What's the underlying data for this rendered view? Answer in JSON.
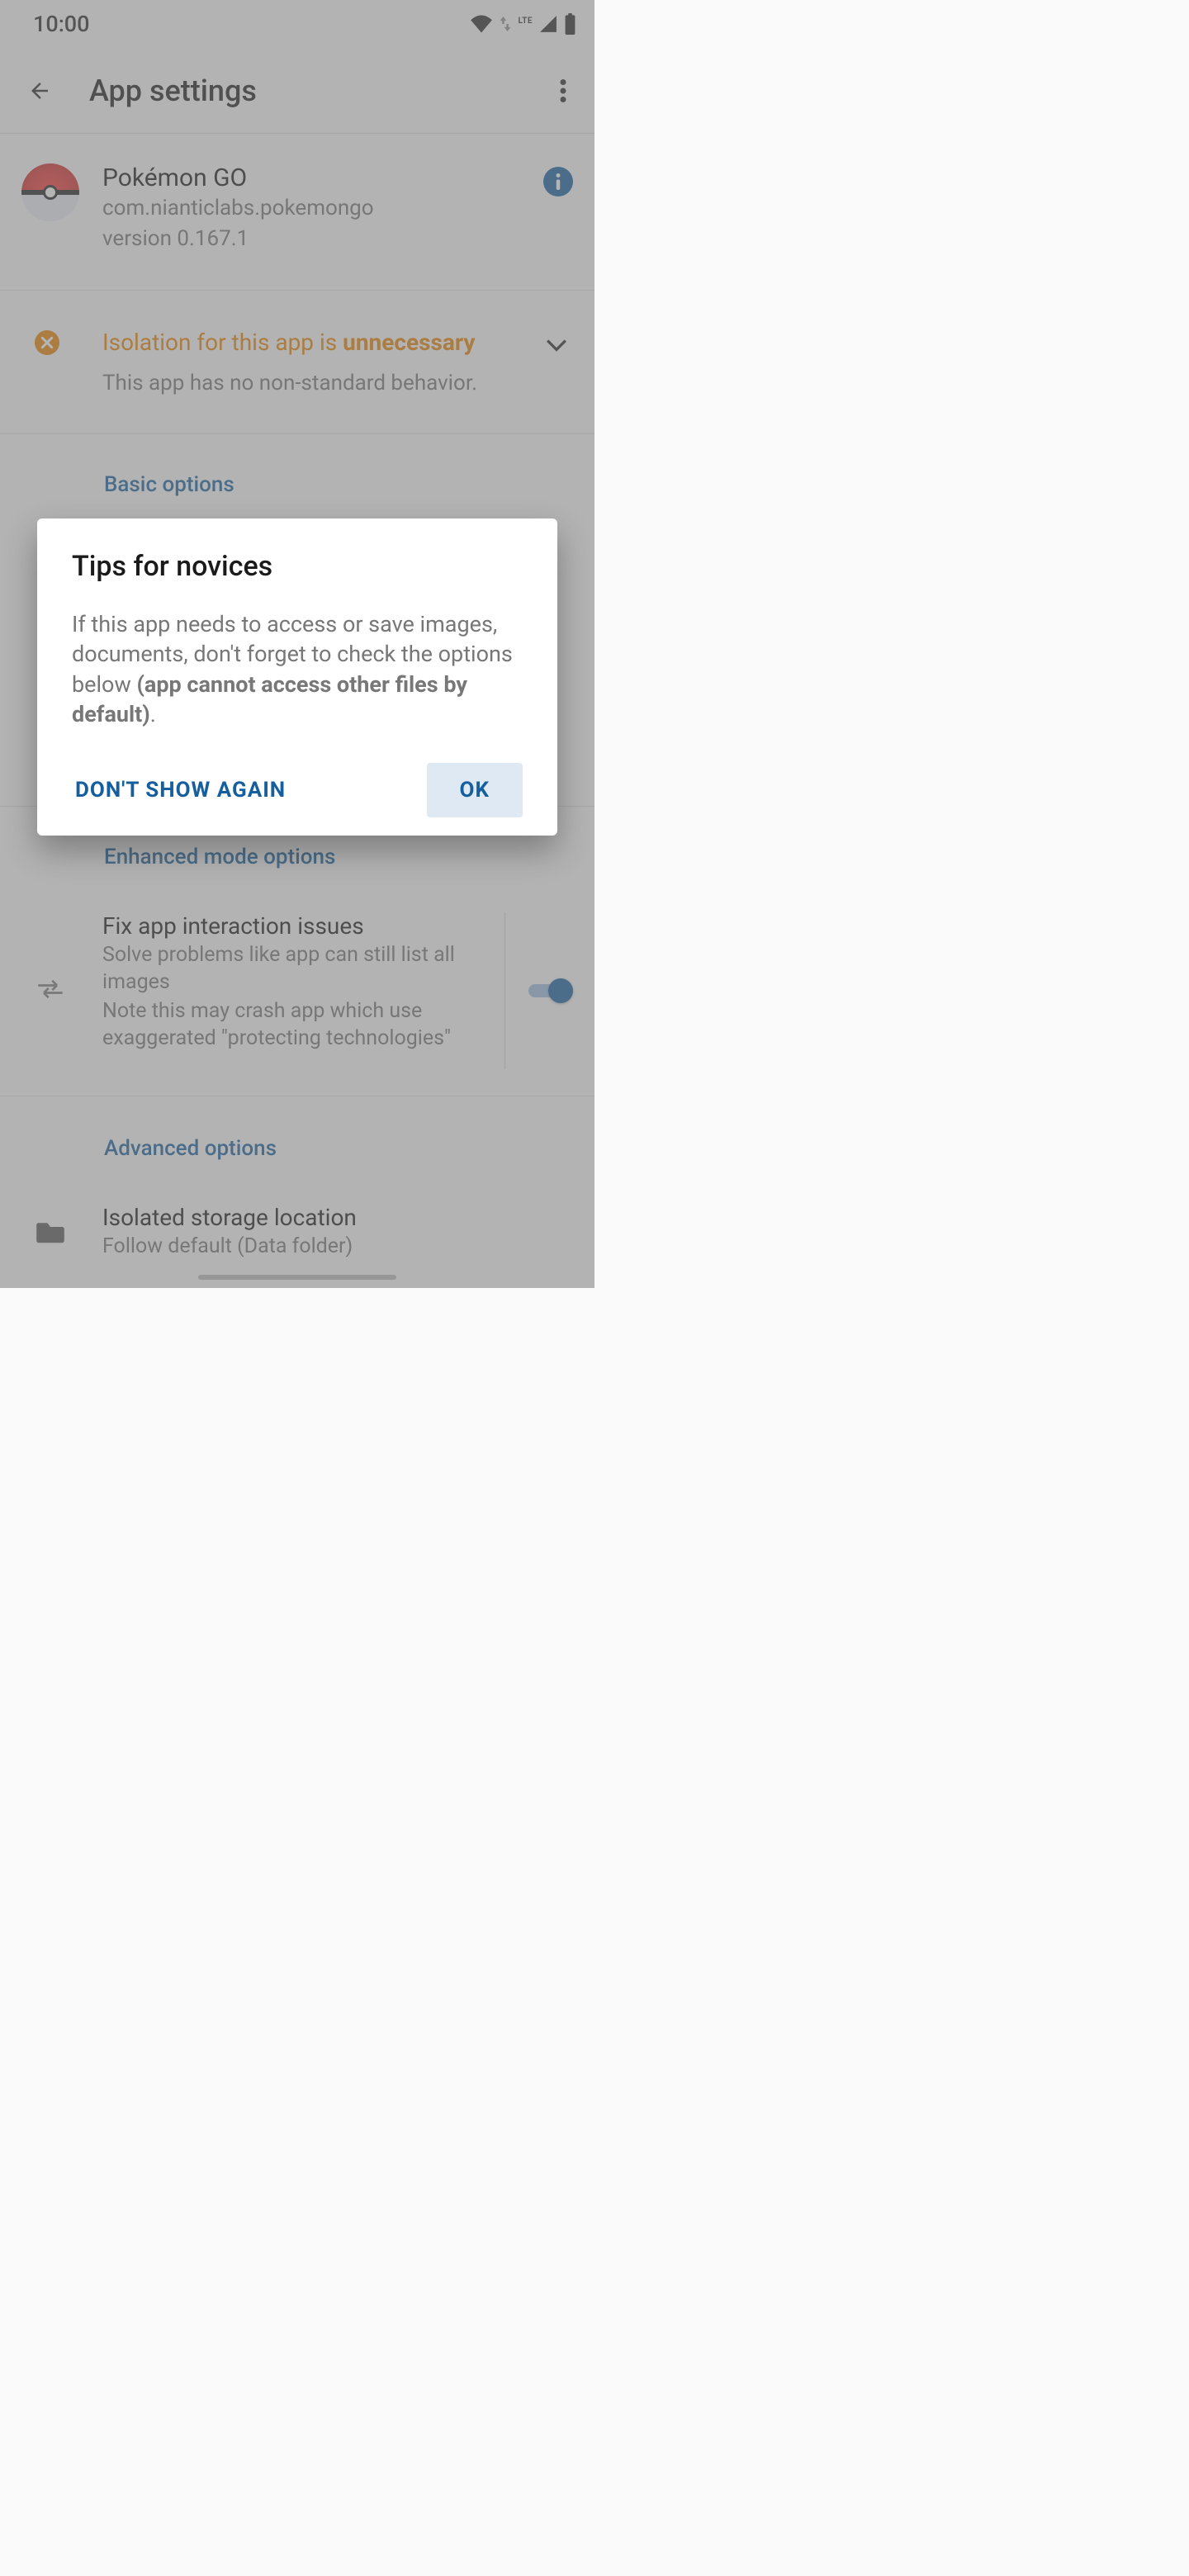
{
  "status": {
    "time": "10:00",
    "lte": "LTE"
  },
  "appbar": {
    "title": "App settings"
  },
  "app": {
    "name": "Pokémon GO",
    "package": "com.nianticlabs.pokemongo",
    "version": "version 0.167.1"
  },
  "notice": {
    "title_pre": "Isolation for this app is ",
    "title_bold": "unnecessary",
    "subtitle": "This app has no non-standard behavior."
  },
  "sections": {
    "basic": "Basic options",
    "enhanced": "Enhanced mode options",
    "advanced": "Advanced options"
  },
  "enhanced": {
    "fix_title": "Fix app interaction issues",
    "fix_sub1": "Solve problems like app can still list all images",
    "fix_sub2": "Note this may crash app which use exaggerated \"protecting technologies\"",
    "fix_enabled": true
  },
  "advanced": {
    "storage_title": "Isolated storage location",
    "storage_sub": "Follow default (Data folder)"
  },
  "dialog": {
    "title": "Tips for novices",
    "body_pre": "If this app needs to access or save images, documents, don't forget to check the options below ",
    "body_bold": "(app cannot access other files by default)",
    "body_post": ".",
    "dont_show": "DON'T SHOW AGAIN",
    "ok": "OK"
  }
}
